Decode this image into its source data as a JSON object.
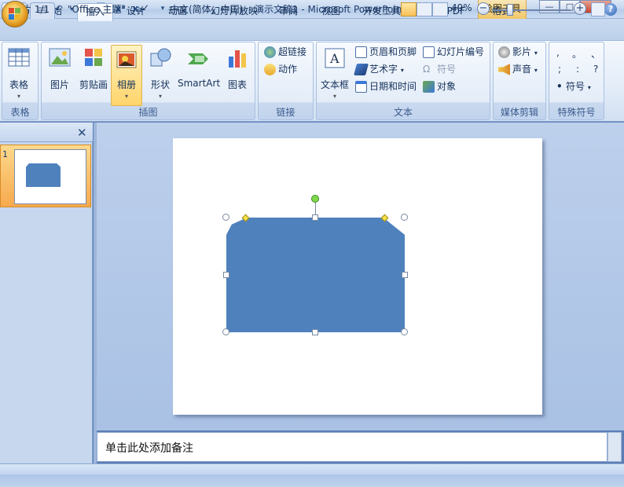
{
  "window": {
    "title": "演示文稿1 - Microsoft PowerPoint",
    "context_tab": "绘图工具",
    "buttons": {
      "minimize": "—",
      "maximize": "□",
      "close": "✕"
    }
  },
  "qat": {
    "undo_icon": "↶",
    "redo_icon": "↷"
  },
  "tabs": [
    {
      "label": "开始"
    },
    {
      "label": "插入"
    },
    {
      "label": "设计"
    },
    {
      "label": "动画"
    },
    {
      "label": "幻灯片放映"
    },
    {
      "label": "审阅"
    },
    {
      "label": "视图"
    },
    {
      "label": "开发工具"
    },
    {
      "label": "WPS PDF"
    },
    {
      "label": "格式"
    }
  ],
  "active_tab": "插入",
  "ribbon": {
    "groups": {
      "table": "表格",
      "illustrations": "插图",
      "links": "链接",
      "text": "文本",
      "media": "媒体剪辑",
      "symbols": "特殊符号"
    },
    "buttons": {
      "table": "表格",
      "picture": "图片",
      "clipart": "剪贴画",
      "album": "相册",
      "shapes": "形状",
      "smartart": "SmartArt",
      "chart": "图表",
      "hyperlink": "超链接",
      "action": "动作",
      "textbox": "文本框",
      "header_footer": "页眉和页脚",
      "wordart": "艺术字",
      "datetime": "日期和时间",
      "slide_number": "幻灯片编号",
      "symbol": "符号",
      "object": "对象",
      "movie": "影片",
      "sound": "声音",
      "special_symbol": "符号"
    },
    "symbol_glyphs": [
      ",",
      "。",
      "、",
      ";",
      ":",
      "?"
    ]
  },
  "notes": {
    "placeholder": "单击此处添加备注"
  },
  "statusbar": {
    "slide": "幻灯片 1/1",
    "theme": "\"Office 主题\"",
    "language": "中文(简体，中国)",
    "zoom": "49%"
  },
  "colors": {
    "shape_fill": "#4f81bd",
    "accent": "#f7c158"
  }
}
